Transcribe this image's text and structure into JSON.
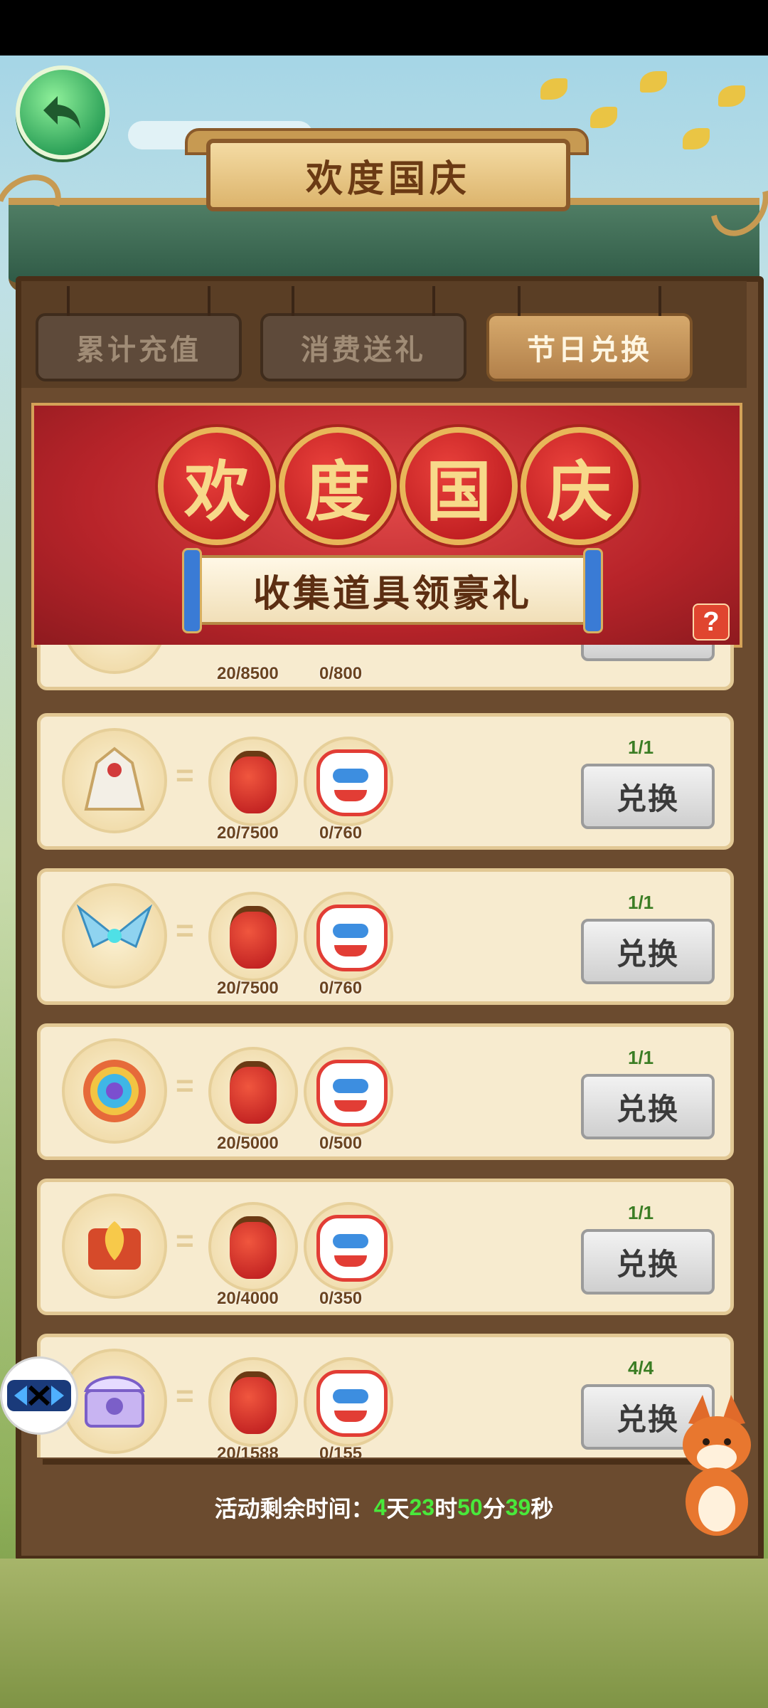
{
  "header": {
    "title": "欢度国庆"
  },
  "tabs": [
    {
      "label": "累计充值",
      "active": false
    },
    {
      "label": "消费送礼",
      "active": false
    },
    {
      "label": "节日兑换",
      "active": true
    }
  ],
  "banner": {
    "characters": [
      "欢",
      "度",
      "国",
      "庆"
    ],
    "subtitle": "收集道具领豪礼",
    "help_label": "?"
  },
  "rows": [
    {
      "reward_icon": "purple-mount-icon",
      "m1": "20/8500",
      "m2": "0/800",
      "limit": "",
      "button": ""
    },
    {
      "reward_icon": "white-robe-costume-icon",
      "m1": "20/7500",
      "m2": "0/760",
      "limit": "1/1",
      "button": "兑换"
    },
    {
      "reward_icon": "blue-wings-icon",
      "m1": "20/7500",
      "m2": "0/760",
      "limit": "1/1",
      "button": "兑换"
    },
    {
      "reward_icon": "rainbow-portal-icon",
      "m1": "20/5000",
      "m2": "0/500",
      "limit": "1/1",
      "button": "兑换"
    },
    {
      "reward_icon": "golden-phoenix-scroll-icon",
      "m1": "20/4000",
      "m2": "0/350",
      "limit": "1/1",
      "button": "兑换"
    },
    {
      "reward_icon": "purple-treasure-chest-icon",
      "m1": "20/1588",
      "m2": "0/155",
      "limit": "4/4",
      "button": "兑换"
    }
  ],
  "material_labels": {
    "equals": "="
  },
  "footer": {
    "label": "活动剩余时间：",
    "days": "4",
    "days_unit": "天",
    "hours": "23",
    "hours_unit": "时",
    "minutes": "50",
    "minutes_unit": "分",
    "seconds": "39",
    "seconds_unit": "秒"
  },
  "colors": {
    "accent_green": "#49e83b",
    "banner_red": "#b8242a",
    "limit_green": "#3b7d24"
  }
}
